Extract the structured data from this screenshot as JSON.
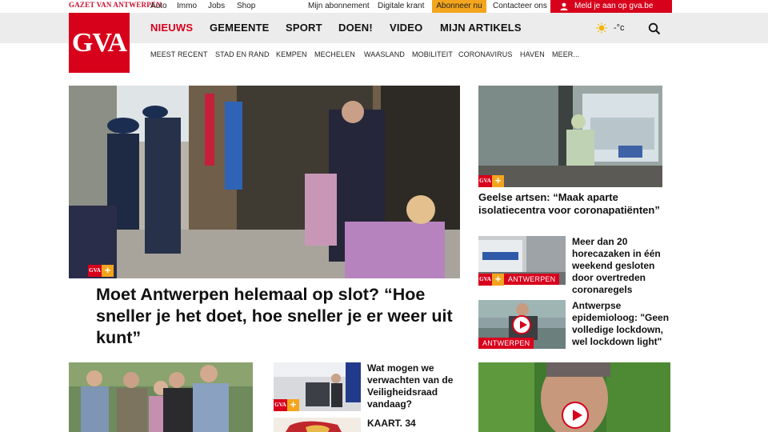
{
  "header": {
    "strap": "GAZET VAN ANTWERPEN",
    "util_links": [
      "Auto",
      "Immo",
      "Jobs",
      "Shop"
    ],
    "account_links": [
      "Mijn abonnement",
      "Digitale krant"
    ],
    "subscribe": "Abonneer nu",
    "contact": "Contacteer ons",
    "login": "Meld je aan op gva.be",
    "logo": "GVA",
    "main_nav": [
      "NIEUWS",
      "GEMEENTE",
      "SPORT",
      "DOEN!",
      "VIDEO",
      "MIJN ARTIKELS"
    ],
    "temperature": "-°c",
    "sub_nav": [
      "MEEST RECENT",
      "STAD EN RAND",
      "KEMPEN",
      "MECHELEN",
      "WAASLAND",
      "MOBILITEIT",
      "CORONAVIRUS",
      "HAVEN",
      "MEER..."
    ]
  },
  "articles": {
    "main": {
      "badge": "GVA",
      "headline": "Moet Antwerpen helemaal op slot? “Hoe sneller je het doet, hoe sneller je er weer uit kunt”"
    },
    "side1": {
      "badge": "GVA",
      "headline": "Geelse artsen: “Maak aparte isolatiecentra voor coronapatiënten”"
    },
    "side2": {
      "badge": "GVA",
      "tag": "ANTWERPEN",
      "headline": "Meer dan 20 horecazaken in één weekend gesloten door overtreden coronaregels"
    },
    "side3": {
      "tag": "ANTWERPEN",
      "headline": "Antwerpse epidemioloog: \"Geen volledige lockdown, wel lockdown light\""
    },
    "small1": {
      "badge": "GVA",
      "headline": "Wat mogen we verwachten van de Veiligheidsraad vandaag?"
    },
    "small2": {
      "headline": "KAART. 34"
    }
  },
  "colors": {
    "brand_red": "#d7011c",
    "accent_orange": "#f3a51d",
    "nav_grey": "#ececec"
  }
}
